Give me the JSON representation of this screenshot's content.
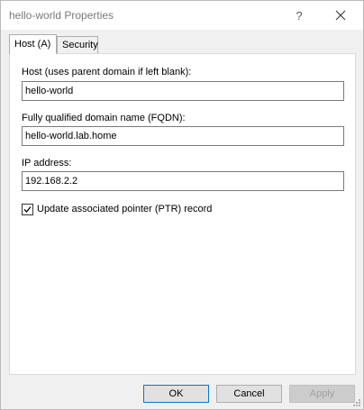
{
  "window": {
    "title": "hello-world Properties",
    "help_glyph": "?",
    "help_icon": "question-mark-icon",
    "close_icon": "close-icon"
  },
  "tabs": [
    {
      "label": "Host (A)",
      "active": true
    },
    {
      "label": "Security",
      "active": false
    }
  ],
  "form": {
    "host_label": "Host (uses parent domain if left blank):",
    "host_value": "hello-world",
    "fqdn_label": "Fully qualified domain name (FQDN):",
    "fqdn_value": "hello-world.lab.home",
    "ip_label": "IP address:",
    "ip_value": "192.168.2.2",
    "ptr_label": "Update associated pointer (PTR) record",
    "ptr_checked": true
  },
  "buttons": {
    "ok": "OK",
    "cancel": "Cancel",
    "apply": "Apply",
    "apply_enabled": false
  },
  "colors": {
    "accent": "#0078d7",
    "panel_bg": "#ffffff",
    "dialog_bg": "#f0f0f0"
  }
}
